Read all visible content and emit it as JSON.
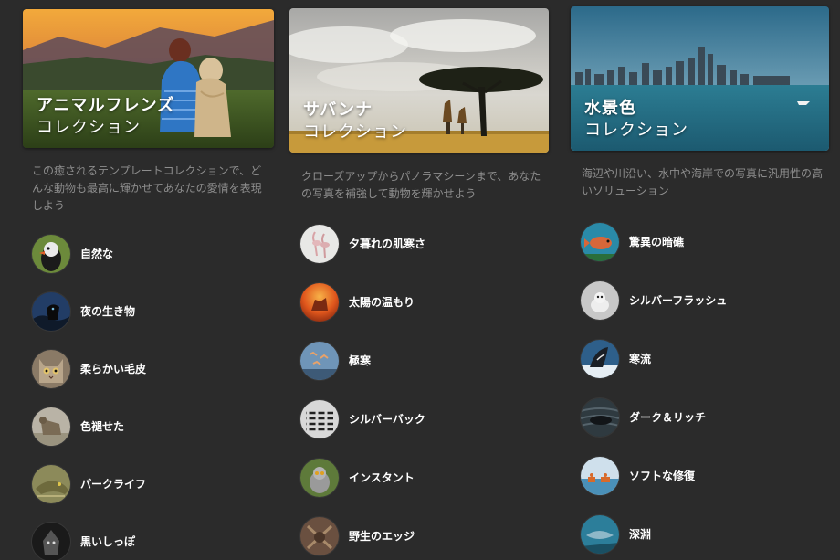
{
  "collections": [
    {
      "title": "アニマルフレンズ",
      "subtitle": "コレクション",
      "description": "この癒されるテンプレートコレクションで、どんな動物も最高に輝かせてあなたの愛情を表現しよう",
      "items": [
        {
          "label": "自然な",
          "icon": "puffin-thumbnail"
        },
        {
          "label": "夜の生き物",
          "icon": "night-animal-thumbnail"
        },
        {
          "label": "柔らかい毛皮",
          "icon": "cat-thumbnail"
        },
        {
          "label": "色褪せた",
          "icon": "faded-animal-thumbnail"
        },
        {
          "label": "パークライフ",
          "icon": "lizard-thumbnail"
        },
        {
          "label": "黒いしっぽ",
          "icon": "black-tail-thumbnail"
        }
      ]
    },
    {
      "title": "サバンナ",
      "subtitle": "コレクション",
      "description": "クローズアップからパノラマシーンまで、あなたの写真を補強して動物を輝かせよう",
      "items": [
        {
          "label": "夕暮れの肌寒さ",
          "icon": "flamingo-thumbnail"
        },
        {
          "label": "太陽の温もり",
          "icon": "warm-sun-thumbnail"
        },
        {
          "label": "極寒",
          "icon": "birds-thumbnail"
        },
        {
          "label": "シルバーバック",
          "icon": "zebra-thumbnail"
        },
        {
          "label": "インスタント",
          "icon": "lemur-thumbnail"
        },
        {
          "label": "野生のエッジ",
          "icon": "wild-animal-thumbnail"
        }
      ]
    },
    {
      "title": "水景色",
      "subtitle": "コレクション",
      "description": "海辺や川沿い、水中や海岸での写真に汎用性の高いソリューション",
      "items": [
        {
          "label": "驚異の暗礁",
          "icon": "reef-thumbnail"
        },
        {
          "label": "シルバーフラッシュ",
          "icon": "silver-seal-thumbnail"
        },
        {
          "label": "寒流",
          "icon": "whale-thumbnail"
        },
        {
          "label": "ダーク＆リッチ",
          "icon": "dark-seal-thumbnail"
        },
        {
          "label": "ソフトな修復",
          "icon": "beach-thumbnail"
        },
        {
          "label": "深淵",
          "icon": "deep-sea-thumbnail"
        }
      ]
    }
  ]
}
